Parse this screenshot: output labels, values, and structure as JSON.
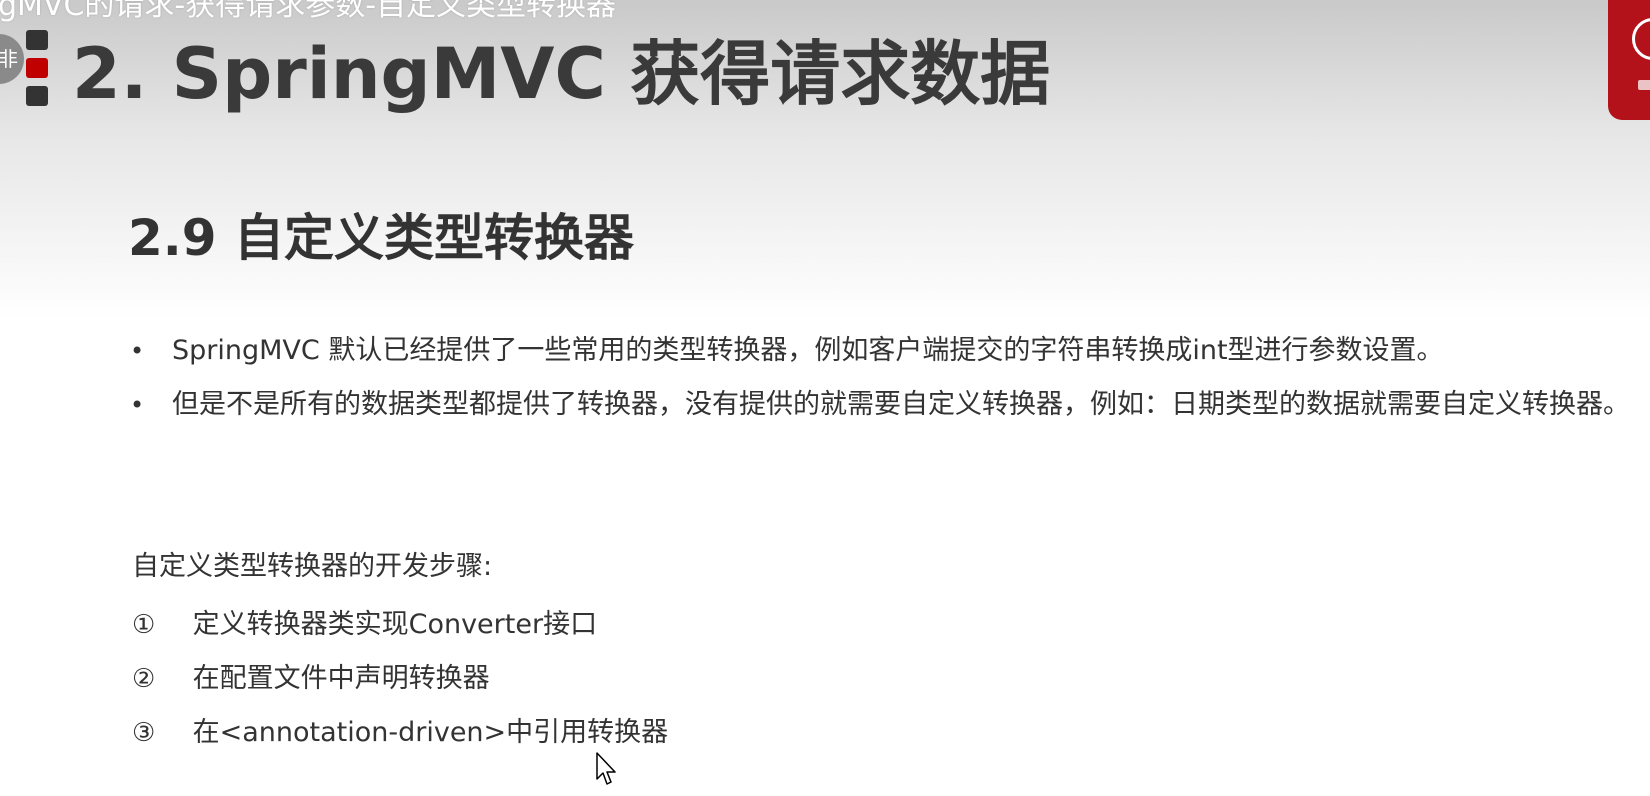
{
  "video_title_overlay": "gMVC的请求-获得请求参数-自定义类型转换器",
  "avatar_text": "非",
  "slide": {
    "main_title": "2. SpringMVC 获得请求数据",
    "section_title": "2.9 自定义类型转换器",
    "bullets": [
      {
        "marker": "•",
        "text": "SpringMVC 默认已经提供了一些常用的类型转换器，例如客户端提交的字符串转换成int型进行参数设置。"
      },
      {
        "marker": "•",
        "text": "但是不是所有的数据类型都提供了转换器，没有提供的就需要自定义转换器，例如：日期类型的数据就需要自定义转换器。"
      }
    ],
    "steps_heading": "自定义类型转换器的开发步骤:",
    "steps": [
      {
        "num": "①",
        "text": "定义转换器类实现Converter接口"
      },
      {
        "num": "②",
        "text": "在配置文件中声明转换器"
      },
      {
        "num": "③",
        "text": "在<annotation-driven>中引用转换器"
      }
    ]
  },
  "colors": {
    "accent_red": "#c00000",
    "badge_red": "#b3121a",
    "text_dark": "#333333"
  },
  "icons": {
    "corner_badge": "brand-logo-icon",
    "cursor": "mouse-pointer-icon"
  }
}
